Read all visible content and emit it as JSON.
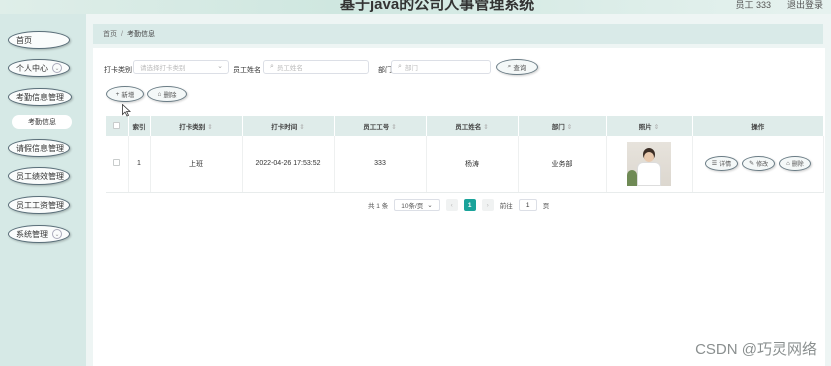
{
  "header": {
    "title": "基于java的公司人事管理系统",
    "user_text": "员工 333",
    "logout": "退出登录"
  },
  "sidebar": {
    "items": [
      {
        "label": "首页"
      },
      {
        "label": "个人中心"
      },
      {
        "label": "考勤信息管理"
      },
      {
        "label": "考勤信息"
      },
      {
        "label": "请假信息管理"
      },
      {
        "label": "员工绩效管理"
      },
      {
        "label": "员工工资管理"
      },
      {
        "label": "系统管理"
      }
    ]
  },
  "breadcrumb": {
    "home": "首页",
    "separator": "/",
    "current": "考勤信息"
  },
  "search": {
    "punch_type_label": "打卡类别",
    "punch_type_placeholder": "请选择打卡类别",
    "employee_name_label": "员工姓名",
    "employee_name_placeholder": "员工姓名",
    "department_label": "部门",
    "department_placeholder": "部门",
    "search_button": "查询"
  },
  "toolbar": {
    "add_button": "新增",
    "delete_button": "删除"
  },
  "table": {
    "columns": [
      "索引",
      "打卡类别",
      "打卡时间",
      "员工工号",
      "员工姓名",
      "部门",
      "照片",
      "操作"
    ],
    "rows": [
      {
        "index": "1",
        "punch_type": "上班",
        "punch_time": "2022-04-26 17:53:52",
        "employee_id": "333",
        "employee_name": "杨涛",
        "department": "业务部"
      }
    ],
    "row_actions": {
      "detail": "详情",
      "edit": "修改",
      "delete": "删除"
    }
  },
  "pagination": {
    "total_text": "共 1 条",
    "page_size": "10条/页",
    "current_page": "1",
    "goto_label": "前往",
    "goto_value": "1",
    "page_unit": "页"
  },
  "watermark": {
    "text": "CSDN @巧灵网络"
  },
  "colors": {
    "sidebar_bg": "#d6e9e6",
    "main_bg": "#eef5f4",
    "accent": "#1aa39a"
  }
}
